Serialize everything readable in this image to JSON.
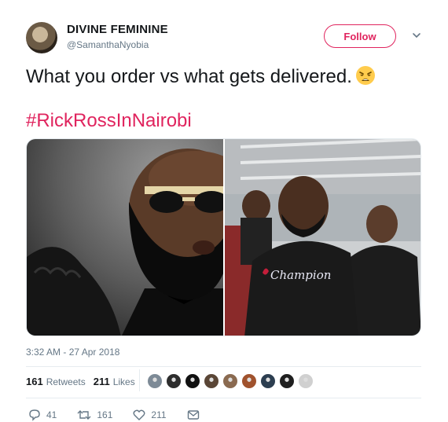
{
  "user": {
    "display_name": "DIVINE FEMININE",
    "handle": "@SamanthaNyobia",
    "avatar_icon": "profile-photo"
  },
  "header": {
    "follow_label": "Follow",
    "menu_icon": "chevron-down-icon",
    "accent": "#e0245e"
  },
  "tweet": {
    "text": "What you order vs what gets delivered.",
    "emoji_icon": "weary-face-emoji",
    "hashtag": "#RickRossInNairobi"
  },
  "media": {
    "left_photo": "bearded-man-sunglasses-photo",
    "right_photo": "man-in-champion-hoodie-photo",
    "hoodie_text": "Champion"
  },
  "meta": {
    "timestamp": "3:32 AM - 27 Apr 2018"
  },
  "stats": {
    "retweets_count": "161",
    "retweets_label": "Retweets",
    "likes_count": "211",
    "likes_label": "Likes",
    "liker_avatar_colors": [
      "#7d8a96",
      "#2d2d2d",
      "#111111",
      "#5a4636",
      "#8a6a50",
      "#a0522d",
      "#2c3e50",
      "#1f1f1f",
      "#d0d0d0"
    ]
  },
  "actions": {
    "reply_count": "41",
    "retweet_count": "161",
    "like_count": "211"
  }
}
